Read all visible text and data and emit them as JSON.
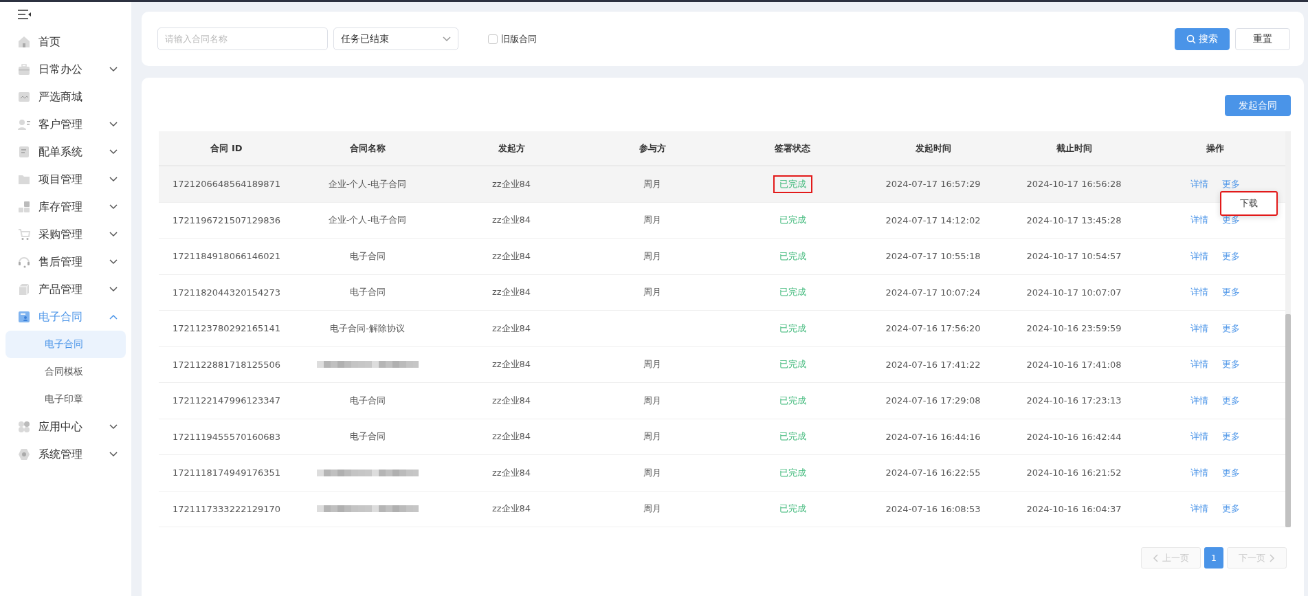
{
  "sidebar": {
    "items": [
      {
        "label": "首页",
        "selected": false
      },
      {
        "label": "日常办公",
        "expandable": true,
        "expanded": false,
        "selected": false
      },
      {
        "label": "严选商城",
        "selected": false
      },
      {
        "label": "客户管理",
        "expandable": true,
        "expanded": false,
        "selected": false
      },
      {
        "label": "配单系统",
        "expandable": true,
        "expanded": false,
        "selected": false
      },
      {
        "label": "项目管理",
        "expandable": true,
        "expanded": false,
        "selected": false
      },
      {
        "label": "库存管理",
        "expandable": true,
        "expanded": false,
        "selected": false
      },
      {
        "label": "采购管理",
        "expandable": true,
        "expanded": false,
        "selected": false
      },
      {
        "label": "售后管理",
        "expandable": true,
        "expanded": false,
        "selected": false
      },
      {
        "label": "产品管理",
        "expandable": true,
        "expanded": false,
        "selected": false
      },
      {
        "label": "电子合同",
        "expandable": true,
        "expanded": true,
        "selected": true,
        "children": [
          {
            "label": "电子合同",
            "selected": true
          },
          {
            "label": "合同模板",
            "selected": false
          },
          {
            "label": "电子印章",
            "selected": false
          }
        ]
      },
      {
        "label": "应用中心",
        "expandable": true,
        "expanded": false,
        "selected": false
      },
      {
        "label": "系统管理",
        "expandable": true,
        "expanded": false,
        "selected": false
      }
    ]
  },
  "filters": {
    "search": {
      "placeholder": "请输入合同名称"
    },
    "status_select": {
      "value": "任务已结束"
    },
    "old_version": {
      "label": "旧版合同",
      "checked": false
    },
    "buttons": [
      {
        "label": "搜索",
        "kind": "primary"
      },
      {
        "label": "重置",
        "kind": "default"
      }
    ]
  },
  "toolbar": {
    "button": "发起合同"
  },
  "table": {
    "columns": [
      "合同 ID",
      "合同名称",
      "发起方",
      "参与方",
      "签署状态",
      "发起时间",
      "截止时间",
      "操作"
    ],
    "rows": [
      {
        "id": "1721206648564189871",
        "name": "企业-个人-电子合同",
        "initiator": "zz企业84",
        "participant": "周月",
        "status": "已完成",
        "status_highlighted": true,
        "start": "2024-07-17 16:57:29",
        "end": "2024-10-17 16:56:28",
        "actions": [
          "详情",
          "更多"
        ],
        "menu": {
          "items": [
            "下载"
          ],
          "highlighted": true
        }
      },
      {
        "id": "1721196721507129836",
        "name": "企业-个人-电子合同",
        "initiator": "zz企业84",
        "participant": "周月",
        "status": "已完成",
        "status_highlighted": false,
        "start": "2024-07-17 14:12:02",
        "end": "2024-10-17 13:45:28",
        "actions": [
          "详情",
          "更多"
        ]
      },
      {
        "id": "1721184918066146021",
        "name": "电子合同",
        "initiator": "zz企业84",
        "participant": "周月",
        "status": "已完成",
        "status_highlighted": false,
        "start": "2024-07-17 10:55:18",
        "end": "2024-10-17 10:54:57",
        "actions": [
          "详情",
          "更多"
        ]
      },
      {
        "id": "1721182044320154273",
        "name": "电子合同",
        "initiator": "zz企业84",
        "participant": "周月",
        "status": "已完成",
        "status_highlighted": false,
        "start": "2024-07-17 10:07:24",
        "end": "2024-10-17 10:07:07",
        "actions": [
          "详情",
          "更多"
        ]
      },
      {
        "id": "1721123780292165141",
        "name": "电子合同-解除协议",
        "initiator": "zz企业84",
        "status": "已完成",
        "status_highlighted": false,
        "start": "2024-07-16 17:56:20",
        "end": "2024-10-16 23:59:59",
        "actions": [
          "详情",
          "更多"
        ]
      },
      {
        "id": "1721122881718125506",
        "name_redacted": true,
        "initiator": "zz企业84",
        "participant": "周月",
        "status": "已完成",
        "status_highlighted": false,
        "start": "2024-07-16 17:41:22",
        "end": "2024-10-16 17:41:08",
        "actions": [
          "详情",
          "更多"
        ]
      },
      {
        "id": "1721122147996123347",
        "name": "电子合同",
        "initiator": "zz企业84",
        "participant": "周月",
        "status": "已完成",
        "status_highlighted": false,
        "start": "2024-07-16 17:29:08",
        "end": "2024-10-16 17:23:13",
        "actions": [
          "详情",
          "更多"
        ]
      },
      {
        "id": "1721119455570160683",
        "name": "电子合同",
        "initiator": "zz企业84",
        "participant": "周月",
        "status": "已完成",
        "status_highlighted": false,
        "start": "2024-07-16 16:44:16",
        "end": "2024-10-16 16:42:44",
        "actions": [
          "详情",
          "更多"
        ]
      },
      {
        "id": "1721118174949176351",
        "name_redacted": true,
        "initiator": "zz企业84",
        "participant": "周月",
        "status": "已完成",
        "status_highlighted": false,
        "start": "2024-07-16 16:22:55",
        "end": "2024-10-16 16:21:52",
        "actions": [
          "详情",
          "更多"
        ]
      },
      {
        "id": "1721117333222129170",
        "name_redacted": true,
        "initiator": "zz企业84",
        "participant": "周月",
        "status": "已完成",
        "status_highlighted": false,
        "start": "2024-07-16 16:08:53",
        "end": "2024-10-16 16:04:37",
        "actions": [
          "详情",
          "更多"
        ]
      }
    ]
  },
  "pagination": {
    "prev": "上一页",
    "pages": [
      {
        "label": "1",
        "selected": true
      }
    ],
    "next": "下一页",
    "prev_disabled": true,
    "next_disabled": true
  }
}
